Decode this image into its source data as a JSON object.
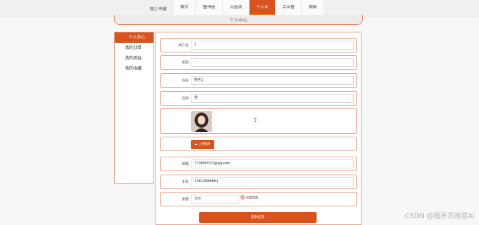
{
  "app": {
    "brand": "网上书城"
  },
  "nav": {
    "items": [
      "首页",
      "图书信息",
      "公告资讯",
      "个人中心",
      "后台管理",
      "购物车"
    ],
    "active_index": 3
  },
  "page": {
    "title": "个人中心"
  },
  "sidebar": {
    "items": [
      "个人中心",
      "我的订单",
      "我的地址",
      "我的收藏"
    ],
    "active_index": 0
  },
  "form": {
    "username": {
      "label": "用户名",
      "value": "1"
    },
    "password": {
      "label": "密码",
      "value": "-"
    },
    "name": {
      "label": "姓名",
      "value": "姓名1"
    },
    "gender": {
      "label": "性别",
      "value": "男"
    },
    "avatar": {
      "upload_label": "上传图片"
    },
    "email": {
      "label": "邮箱",
      "value": "773890001@qq.com"
    },
    "phone": {
      "label": "手机",
      "value": "13823888881"
    },
    "balance": {
      "label": "余额",
      "value": "100",
      "recharge_label": "点我充值"
    },
    "submit_label": "更新信息"
  },
  "watermark": "CSDN @程序员雨哲AI",
  "colors": {
    "accent": "#d9531e",
    "accent_light": "#e2a08a",
    "highlight": "#f0a020"
  }
}
